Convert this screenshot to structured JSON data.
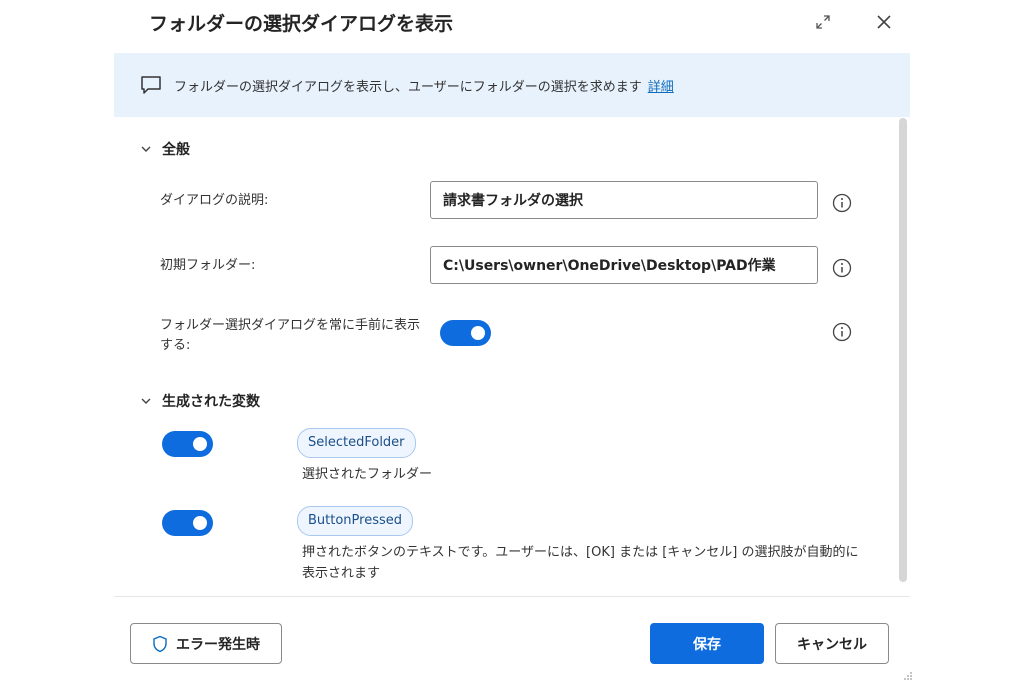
{
  "dialog": {
    "title": "フォルダーの選択ダイアログを表示"
  },
  "banner": {
    "text": "フォルダーの選択ダイアログを表示し、ユーザーにフォルダーの選択を求めます",
    "link": "詳細"
  },
  "general": {
    "header": "全般",
    "fields": [
      {
        "label": "ダイアログの説明:",
        "value": "請求書フォルダの選択"
      },
      {
        "label": "初期フォルダー:",
        "value": "C:\\Users\\owner\\OneDrive\\Desktop\\PAD作業"
      }
    ],
    "topmost": {
      "label": "フォルダー選択ダイアログを常に手前に表示する:",
      "enabled": true
    }
  },
  "variables": {
    "header": "生成された変数",
    "items": [
      {
        "name": "SelectedFolder",
        "description": "選択されたフォルダー",
        "enabled": true
      },
      {
        "name": "ButtonPressed",
        "description": "押されたボタンのテキストです。ユーザーには、[OK] または [キャンセル] の選択肢が自動的に表示されます",
        "enabled": true
      }
    ]
  },
  "footer": {
    "error_button": "エラー発生時",
    "save_button": "保存",
    "cancel_button": "キャンセル"
  },
  "colors": {
    "accent": "#0f6cde",
    "banner_bg": "#e8f2fd",
    "link": "#0f6cbd"
  }
}
